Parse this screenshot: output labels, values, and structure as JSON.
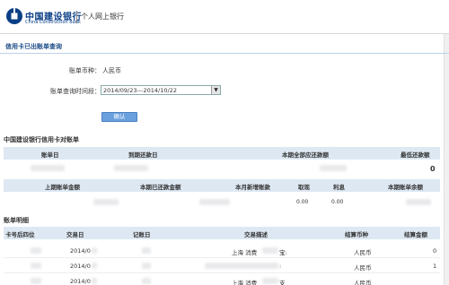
{
  "header": {
    "bank_name_cn": "中国建设银行",
    "bank_name_en": "China Construction Bank",
    "site_name": "个人网上银行"
  },
  "page": {
    "title": "信用卡已出账单查询"
  },
  "form": {
    "currency_label": "账单币种：",
    "currency_value": "人民币",
    "period_label": "账单查询时间段：",
    "period_value": "2014/09/23---2014/10/22",
    "confirm_label": "确认"
  },
  "statement": {
    "title": "中国建设银行信用卡对账单",
    "header1": [
      "账单日",
      "到期还款日",
      "本期全部应还款额",
      "最低还款额"
    ],
    "row1_last": "0",
    "header2": [
      "上期账单金额",
      "本期已还款金额",
      "本月新增账款",
      "取现",
      "利息",
      "本期账单余额"
    ],
    "row2_values": [
      "0.00",
      "0.00"
    ]
  },
  "details": {
    "title": "账单明细",
    "headers": [
      "卡号后四位",
      "交易日",
      "记账日",
      "交易描述",
      "结算币种",
      "结算金额"
    ],
    "rows": [
      {
        "date": "2014/0",
        "desc": "上海  消费",
        "desc_suffix": "宝:",
        "currency": "人民币",
        "amount": "0"
      },
      {
        "date": "2014/0",
        "desc": "",
        "desc_suffix": ":",
        "currency": "人民币",
        "amount": "1"
      },
      {
        "date": "2014/0",
        "desc": "上海  消费",
        "desc_suffix": "支",
        "currency": "人民币",
        "amount": ""
      }
    ]
  }
}
